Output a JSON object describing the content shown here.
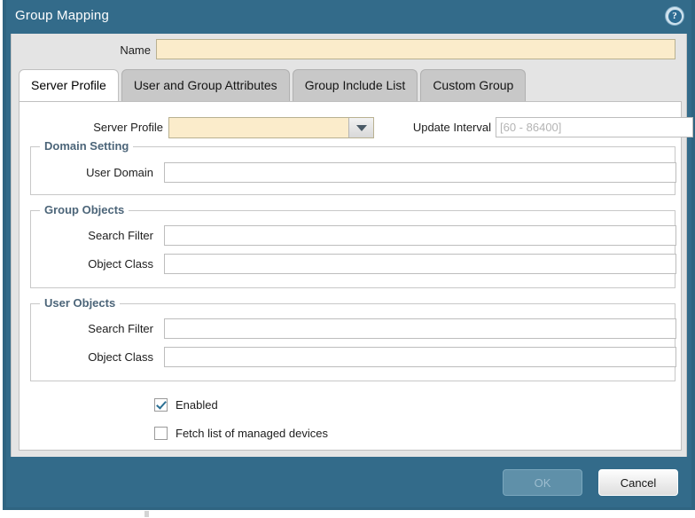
{
  "window": {
    "title": "Group Mapping",
    "help_icon": "help-circle-icon",
    "accent_color": "#336b8a",
    "required_field_color": "#fbeccb"
  },
  "name_field": {
    "label": "Name",
    "value": "",
    "placeholder": ""
  },
  "tabs": [
    {
      "label": "Server Profile",
      "active": true
    },
    {
      "label": "User and Group Attributes",
      "active": false
    },
    {
      "label": "Group Include List",
      "active": false
    },
    {
      "label": "Custom Group",
      "active": false
    }
  ],
  "server_profile_tab": {
    "server_profile": {
      "label": "Server Profile",
      "value": "",
      "dropdown_icon": "chevron-down-icon"
    },
    "update_interval": {
      "label": "Update Interval",
      "value": "",
      "placeholder": "[60 - 86400]"
    },
    "domain_setting": {
      "legend": "Domain Setting",
      "user_domain": {
        "label": "User Domain",
        "value": "",
        "placeholder": ""
      }
    },
    "group_objects": {
      "legend": "Group Objects",
      "search_filter": {
        "label": "Search Filter",
        "value": "",
        "placeholder": ""
      },
      "object_class": {
        "label": "Object Class",
        "value": "",
        "placeholder": ""
      }
    },
    "user_objects": {
      "legend": "User Objects",
      "search_filter": {
        "label": "Search Filter",
        "value": "",
        "placeholder": ""
      },
      "object_class": {
        "label": "Object Class",
        "value": "",
        "placeholder": ""
      }
    },
    "checkboxes": [
      {
        "label": "Enabled",
        "checked": true
      },
      {
        "label": "Fetch list of managed devices",
        "checked": false
      }
    ]
  },
  "footer": {
    "ok_label": "OK",
    "ok_enabled": false,
    "cancel_label": "Cancel",
    "cancel_enabled": true
  }
}
